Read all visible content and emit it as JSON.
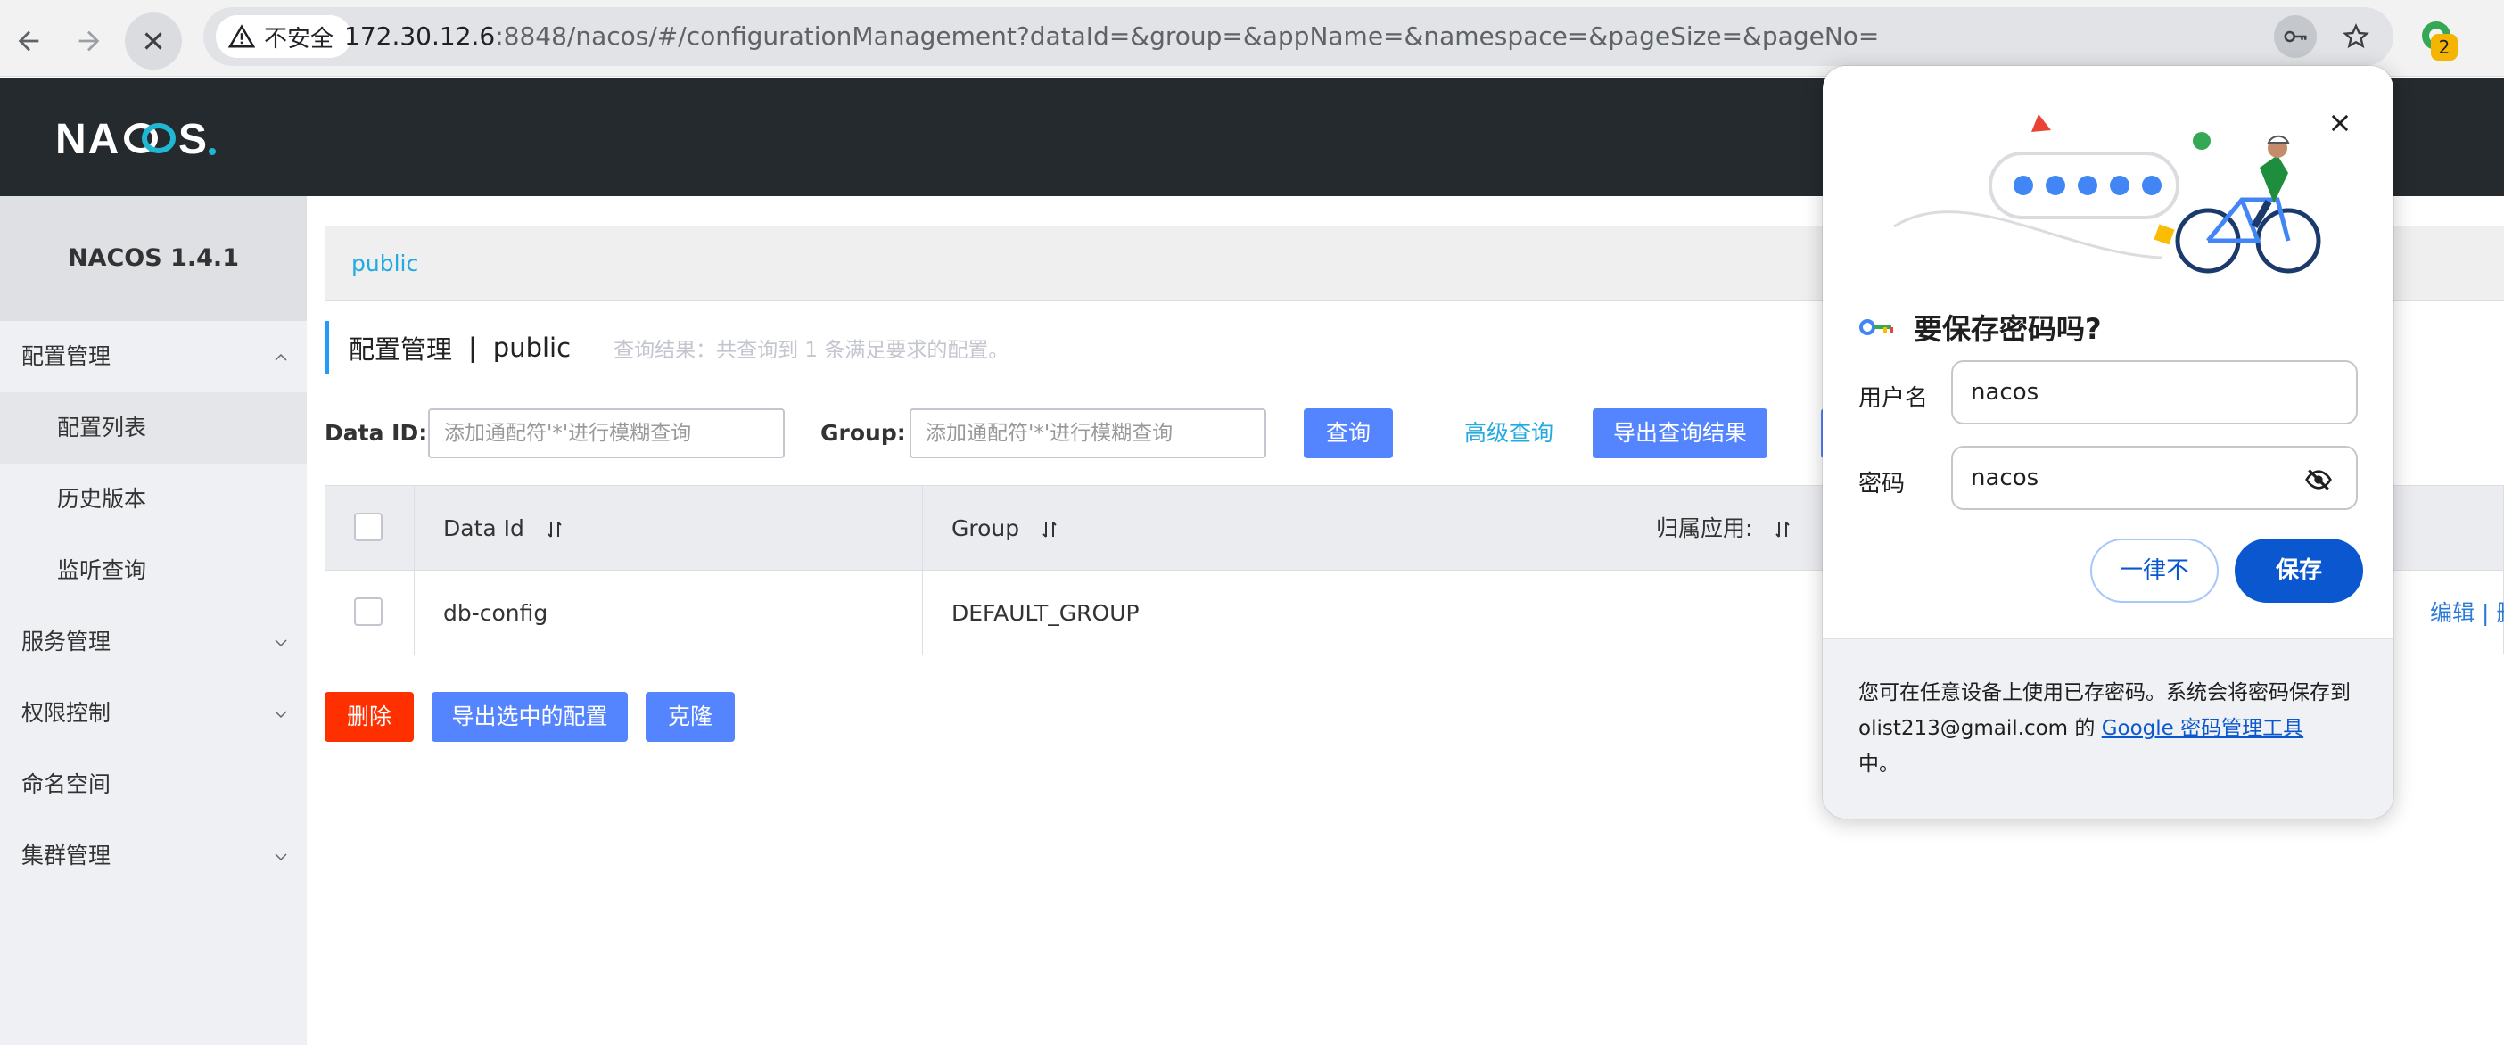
{
  "browser": {
    "security_label": "不安全",
    "url_host": "172.30.12.6",
    "url_rest": ":8848/nacos/#/configurationManagement?dataId=&group=&appName=&namespace=&pageSize=&pageNo=",
    "extension_badge": "2"
  },
  "header": {
    "logo": "NACOS."
  },
  "sidebar": {
    "version": "NACOS 1.4.1",
    "items": [
      {
        "label": "配置管理",
        "expanded": true
      },
      {
        "label": "配置列表",
        "sub": true,
        "active": true
      },
      {
        "label": "历史版本",
        "sub": true
      },
      {
        "label": "监听查询",
        "sub": true
      },
      {
        "label": "服务管理",
        "expanded": false
      },
      {
        "label": "权限控制",
        "expanded": false
      },
      {
        "label": "命名空间"
      },
      {
        "label": "集群管理",
        "expanded": false
      }
    ]
  },
  "main": {
    "namespace": "public",
    "title": "配置管理",
    "title_sep": "|",
    "title_ns": "public",
    "query_result": "查询结果：共查询到 1 条满足要求的配置。",
    "filters": {
      "dataid_label": "Data ID:",
      "dataid_placeholder": "添加通配符'*'进行模糊查询",
      "group_label": "Group:",
      "group_placeholder": "添加通配符'*'进行模糊查询",
      "query_button": "查询",
      "advanced_query": "高级查询",
      "export_button": "导出查询结果"
    },
    "table": {
      "columns": [
        "Data Id",
        "Group",
        "归属应用:"
      ],
      "rows": [
        {
          "data_id": "db-config",
          "group": "DEFAULT_GROUP",
          "app": "",
          "ops": "编辑 | 删除"
        }
      ]
    },
    "actions": {
      "delete": "删除",
      "export_selected": "导出选中的配置",
      "clone": "克隆"
    }
  },
  "popup": {
    "title": "要保存密码吗?",
    "username_label": "用户名",
    "username_value": "nacos",
    "password_label": "密码",
    "password_value": "nacos",
    "never_button": "一律不",
    "save_button": "保存",
    "footer_text_1": "您可在任意设备上使用已存密码。系统会将密码保存到 olist213@gmail.com 的 ",
    "footer_link": "Google 密码管理工具",
    "footer_text_2": "中。"
  },
  "colors": {
    "header_bg": "#252a2f",
    "primary_button": "#5584ff",
    "delete_button": "#ff3000",
    "link": "#24aae0",
    "google_blue": "#0b57d0"
  }
}
